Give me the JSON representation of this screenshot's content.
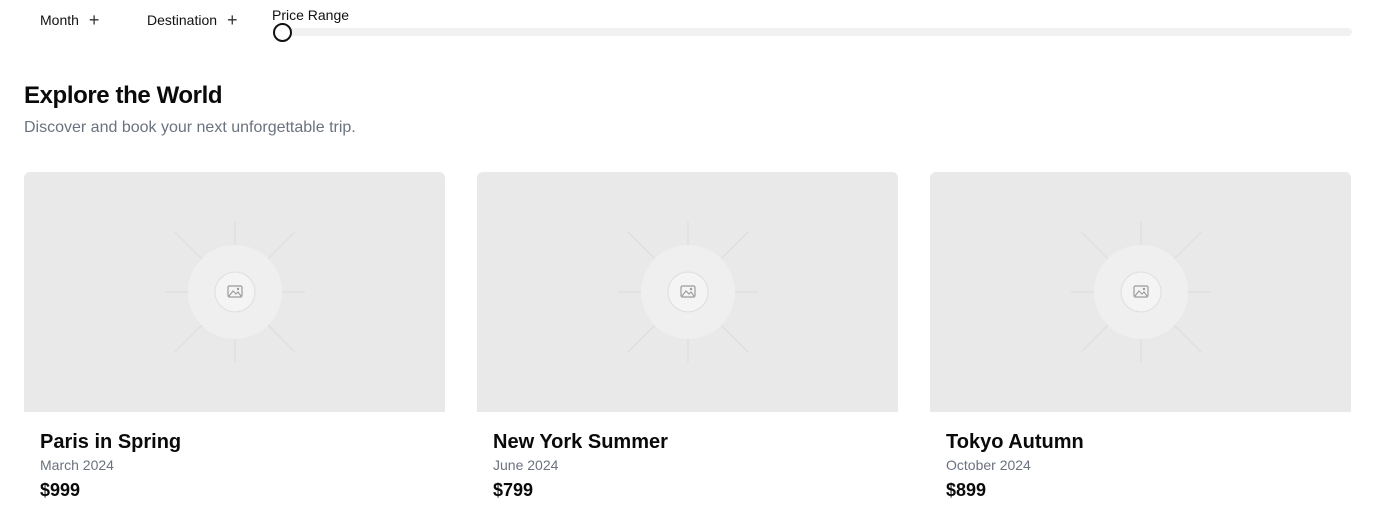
{
  "filters": {
    "month_label": "Month",
    "destination_label": "Destination",
    "price_range_label": "Price Range",
    "price_range_value": 0
  },
  "hero": {
    "title": "Explore the World",
    "subtitle": "Discover and book your next unforgettable trip."
  },
  "trips": [
    {
      "title": "Paris in Spring",
      "date": "March 2024",
      "price": "$999"
    },
    {
      "title": "New York Summer",
      "date": "June 2024",
      "price": "$799"
    },
    {
      "title": "Tokyo Autumn",
      "date": "October 2024",
      "price": "$899"
    }
  ],
  "icons": {
    "filter_add": "plus-icon",
    "image_placeholder": "image-placeholder-icon"
  }
}
